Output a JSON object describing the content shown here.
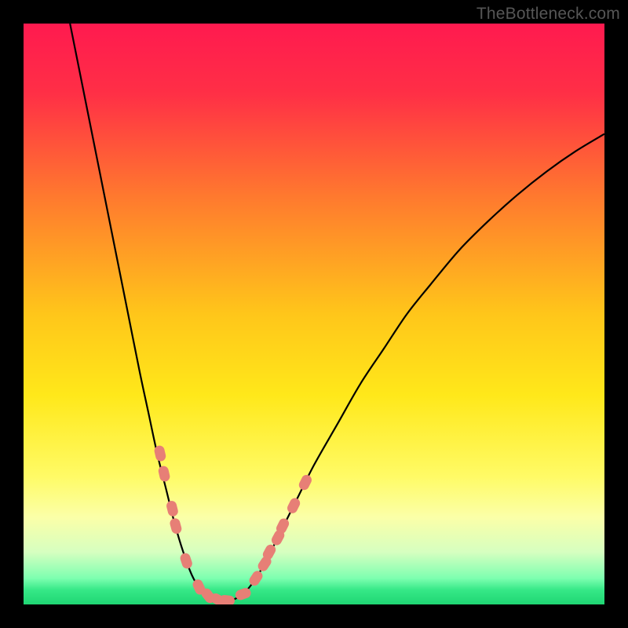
{
  "watermark": "TheBottleneck.com",
  "chart_data": {
    "type": "line",
    "title": "",
    "xlabel": "",
    "ylabel": "",
    "xlim": [
      0,
      100
    ],
    "ylim": [
      0,
      100
    ],
    "gradient": {
      "description": "vertical background gradient indicating bottleneck severity",
      "stops": [
        {
          "pos": 0.0,
          "color": "#ff1a4f"
        },
        {
          "pos": 0.12,
          "color": "#ff2f46"
        },
        {
          "pos": 0.3,
          "color": "#ff7a2e"
        },
        {
          "pos": 0.5,
          "color": "#ffc61a"
        },
        {
          "pos": 0.64,
          "color": "#ffe81a"
        },
        {
          "pos": 0.78,
          "color": "#fffb66"
        },
        {
          "pos": 0.85,
          "color": "#fbffa8"
        },
        {
          "pos": 0.91,
          "color": "#d6ffc0"
        },
        {
          "pos": 0.955,
          "color": "#7dffb0"
        },
        {
          "pos": 0.975,
          "color": "#36e887"
        },
        {
          "pos": 1.0,
          "color": "#1fd673"
        }
      ]
    },
    "curve": {
      "description": "bottleneck V-curve; y=0 is bottom (optimal), y=100 is top",
      "points": [
        {
          "x": 8.0,
          "y": 100.0
        },
        {
          "x": 10.0,
          "y": 90.0
        },
        {
          "x": 12.0,
          "y": 80.0
        },
        {
          "x": 14.0,
          "y": 70.0
        },
        {
          "x": 16.0,
          "y": 60.0
        },
        {
          "x": 18.0,
          "y": 50.0
        },
        {
          "x": 20.0,
          "y": 40.0
        },
        {
          "x": 21.5,
          "y": 33.0
        },
        {
          "x": 23.0,
          "y": 26.0
        },
        {
          "x": 24.5,
          "y": 20.0
        },
        {
          "x": 26.0,
          "y": 14.0
        },
        {
          "x": 27.5,
          "y": 9.0
        },
        {
          "x": 29.0,
          "y": 5.0
        },
        {
          "x": 30.5,
          "y": 2.5
        },
        {
          "x": 32.0,
          "y": 1.2
        },
        {
          "x": 34.0,
          "y": 0.6
        },
        {
          "x": 36.0,
          "y": 0.8
        },
        {
          "x": 38.0,
          "y": 2.0
        },
        {
          "x": 40.0,
          "y": 4.5
        },
        {
          "x": 42.0,
          "y": 8.0
        },
        {
          "x": 44.0,
          "y": 12.0
        },
        {
          "x": 47.0,
          "y": 18.0
        },
        {
          "x": 50.0,
          "y": 24.0
        },
        {
          "x": 54.0,
          "y": 31.0
        },
        {
          "x": 58.0,
          "y": 38.0
        },
        {
          "x": 62.0,
          "y": 44.0
        },
        {
          "x": 66.0,
          "y": 50.0
        },
        {
          "x": 70.0,
          "y": 55.0
        },
        {
          "x": 75.0,
          "y": 61.0
        },
        {
          "x": 80.0,
          "y": 66.0
        },
        {
          "x": 85.0,
          "y": 70.5
        },
        {
          "x": 90.0,
          "y": 74.5
        },
        {
          "x": 95.0,
          "y": 78.0
        },
        {
          "x": 100.0,
          "y": 81.0
        }
      ]
    },
    "markers": {
      "description": "highlighted data points (salmon capsules) on the curve near the valley",
      "color": "#e77f76",
      "points": [
        {
          "x": 23.5,
          "y": 26.0
        },
        {
          "x": 24.2,
          "y": 22.5
        },
        {
          "x": 25.6,
          "y": 16.5
        },
        {
          "x": 26.2,
          "y": 13.5
        },
        {
          "x": 28.0,
          "y": 7.5
        },
        {
          "x": 30.2,
          "y": 3.0
        },
        {
          "x": 31.8,
          "y": 1.5
        },
        {
          "x": 33.5,
          "y": 0.8
        },
        {
          "x": 35.0,
          "y": 0.7
        },
        {
          "x": 37.8,
          "y": 1.8
        },
        {
          "x": 40.0,
          "y": 4.5
        },
        {
          "x": 41.5,
          "y": 7.0
        },
        {
          "x": 42.3,
          "y": 9.0
        },
        {
          "x": 43.8,
          "y": 11.5
        },
        {
          "x": 44.6,
          "y": 13.5
        },
        {
          "x": 46.5,
          "y": 17.0
        },
        {
          "x": 48.5,
          "y": 21.0
        }
      ]
    }
  }
}
